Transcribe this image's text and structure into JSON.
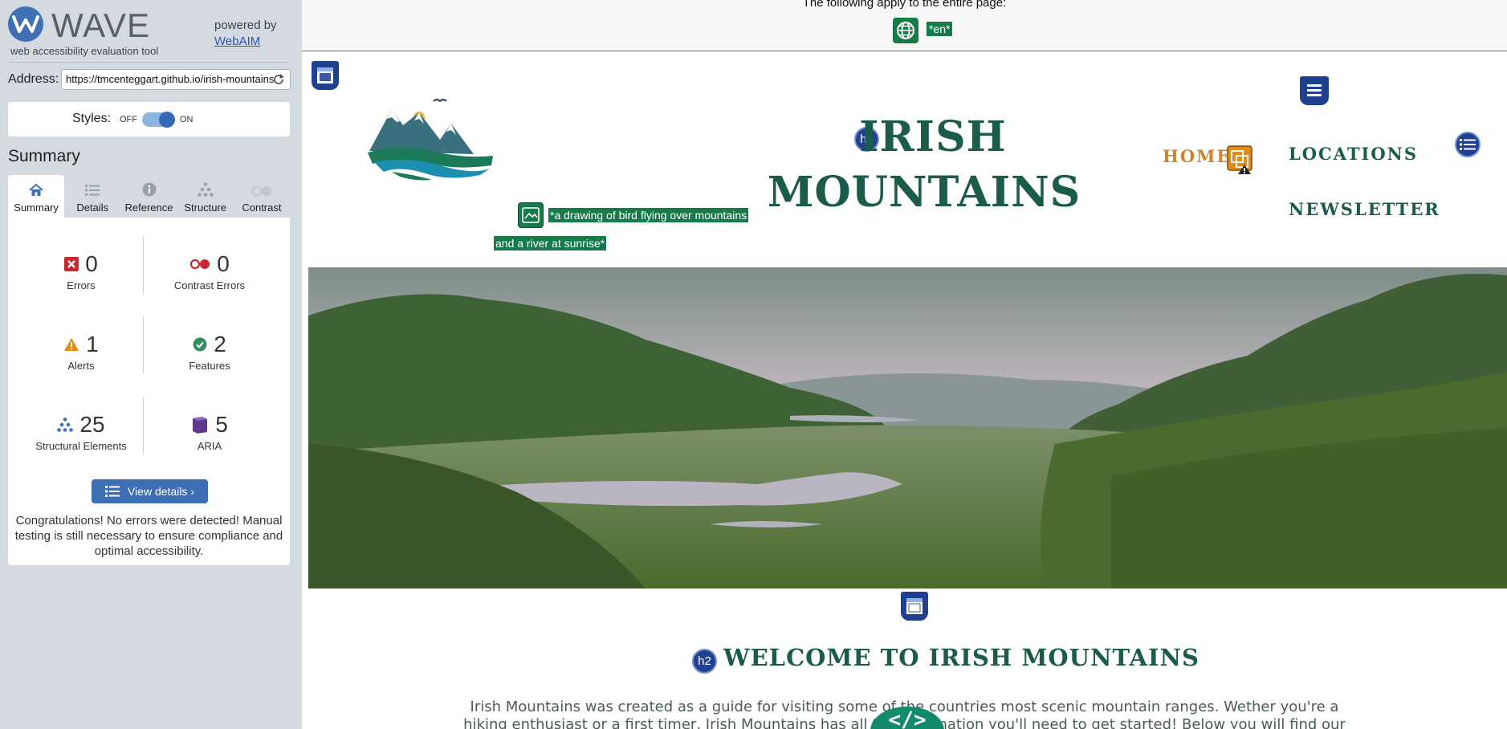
{
  "wave": {
    "brand": "WAVE",
    "tagline": "web accessibility evaluation tool",
    "powered_by": "powered by",
    "powered_link": "WebAIM",
    "address_label": "Address:",
    "address_value": "https://tmcenteggart.github.io/irish-mountains",
    "styles_label": "Styles:",
    "styles_off": "OFF",
    "styles_on": "ON",
    "summary_title": "Summary",
    "tabs": [
      {
        "label": "Summary",
        "icon": "home-icon",
        "active": true
      },
      {
        "label": "Details",
        "icon": "list-icon",
        "active": false
      },
      {
        "label": "Reference",
        "icon": "info-icon",
        "active": false
      },
      {
        "label": "Structure",
        "icon": "structure-icon",
        "active": false
      },
      {
        "label": "Contrast",
        "icon": "contrast-icon",
        "active": false
      }
    ],
    "stats": {
      "errors": {
        "value": "0",
        "label": "Errors"
      },
      "contrast_errors": {
        "value": "0",
        "label": "Contrast Errors"
      },
      "alerts": {
        "value": "1",
        "label": "Alerts"
      },
      "features": {
        "value": "2",
        "label": "Features"
      },
      "structural": {
        "value": "25",
        "label": "Structural Elements"
      },
      "aria": {
        "value": "5",
        "label": "ARIA"
      }
    },
    "view_details": "View details ›",
    "congrats": "Congratulations! No errors were detected! Manual testing is still necessary to ensure compliance and optimal accessibility."
  },
  "page": {
    "note": "The following apply to the entire page:",
    "lang": "*en*",
    "alt_line1": "*a drawing of bird flying over mountains",
    "alt_line2": "and a river at sunrise*",
    "h1_badge": "h1",
    "title_line1": "IRISH",
    "title_line2": "MOUNTAINS",
    "nav": {
      "home": "HOME",
      "locations": "LOCATIONS",
      "newsletter": "NEWSLETTER"
    },
    "h2_badge": "h2",
    "welcome": "WELCOME TO IRISH MOUNTAINS",
    "intro": "Irish Mountains was created as a guide for visiting some of the countries most scenic mountain ranges. Wether you're a hiking enthusiast or a first timer, Irish Mountains has all the information you'll need to get started! Below you will find our 'Hiking",
    "code_glyph": "</>"
  },
  "colors": {
    "wave_bg": "#d5dae1",
    "wave_blue": "#3c6fb6",
    "site_green": "#1b5b4b",
    "nav_active": "#d5822a",
    "alt_green": "#167a4b",
    "aria_blue": "#1f3f8f"
  }
}
